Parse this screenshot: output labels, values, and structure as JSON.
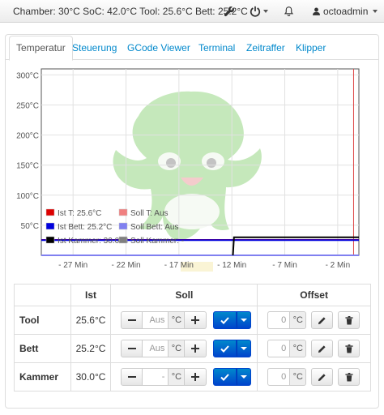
{
  "navbar": {
    "status": "Chamber: 30°C SoC: 42.0°C Tool: 25.6°C Bett: 25.2°C",
    "user": "octoadmin"
  },
  "tabs": [
    {
      "label": "Temperatur",
      "active": true
    },
    {
      "label": "Steuerung",
      "active": false
    },
    {
      "label": "GCode Viewer",
      "active": false
    },
    {
      "label": "Terminal",
      "active": false
    },
    {
      "label": "Zeitraffer",
      "active": false
    },
    {
      "label": "Klipper",
      "active": false
    }
  ],
  "chart_data": {
    "type": "line",
    "y_ticks": [
      "300°C",
      "250°C",
      "200°C",
      "150°C",
      "100°C",
      "50°C"
    ],
    "x_ticks": [
      "- 27 Min",
      "- 22 Min",
      "- 17 Min",
      "- 12 Min",
      "- 7 Min",
      "- 2 Min"
    ],
    "ylim": [
      0,
      310
    ],
    "xlim_min": [
      -30,
      0
    ],
    "grid": true,
    "legend": {
      "placement": "bottom-left",
      "entries": [
        {
          "label": "Ist T: 25.6°C",
          "color": "#dd0000"
        },
        {
          "label": "Soll T: Aus",
          "color": "#f08080"
        },
        {
          "label": "Ist Bett: 25.2°C",
          "color": "#0000dd"
        },
        {
          "label": "Soll Bett: Aus",
          "color": "#8080f0"
        },
        {
          "label": "Ist Kammer: 30.0°C",
          "color": "#000000"
        },
        {
          "label": "Soll Kammer: -",
          "color": "#808080"
        }
      ]
    },
    "series": [
      {
        "name": "Ist T: 25.6°C",
        "color": "#dd0000",
        "x": [
          -30,
          0
        ],
        "y": [
          25.6,
          25.6
        ]
      },
      {
        "name": "Ist Bett: 25.2°C",
        "color": "#0000dd",
        "x": [
          -30,
          0
        ],
        "y": [
          25.2,
          25.2
        ]
      },
      {
        "name": "Soll T: Aus",
        "color": "#f08080",
        "x": [
          -30,
          0
        ],
        "y": [
          0,
          0
        ]
      },
      {
        "name": "Soll Bett: Aus",
        "color": "#8080f0",
        "x": [
          -30,
          0
        ],
        "y": [
          0,
          0
        ]
      },
      {
        "name": "Ist Kammer: 30.0°C",
        "color": "#000000",
        "x": [
          -11.9,
          -11.8,
          0
        ],
        "y": [
          0,
          30,
          30
        ]
      }
    ]
  },
  "table": {
    "headers": [
      "",
      "Ist",
      "Soll",
      "Offset"
    ],
    "rows": [
      {
        "name": "Tool",
        "actual": "25.6°C",
        "soll": "Aus",
        "unit": "°C",
        "offset": "0"
      },
      {
        "name": "Bett",
        "actual": "25.2°C",
        "soll": "Aus",
        "unit": "°C",
        "offset": "0"
      },
      {
        "name": "Kammer",
        "actual": "30.0°C",
        "soll": "-",
        "unit": "°C",
        "offset": "0"
      }
    ]
  },
  "colors": {
    "link": "#0088cc",
    "primary": "#0066cc"
  }
}
